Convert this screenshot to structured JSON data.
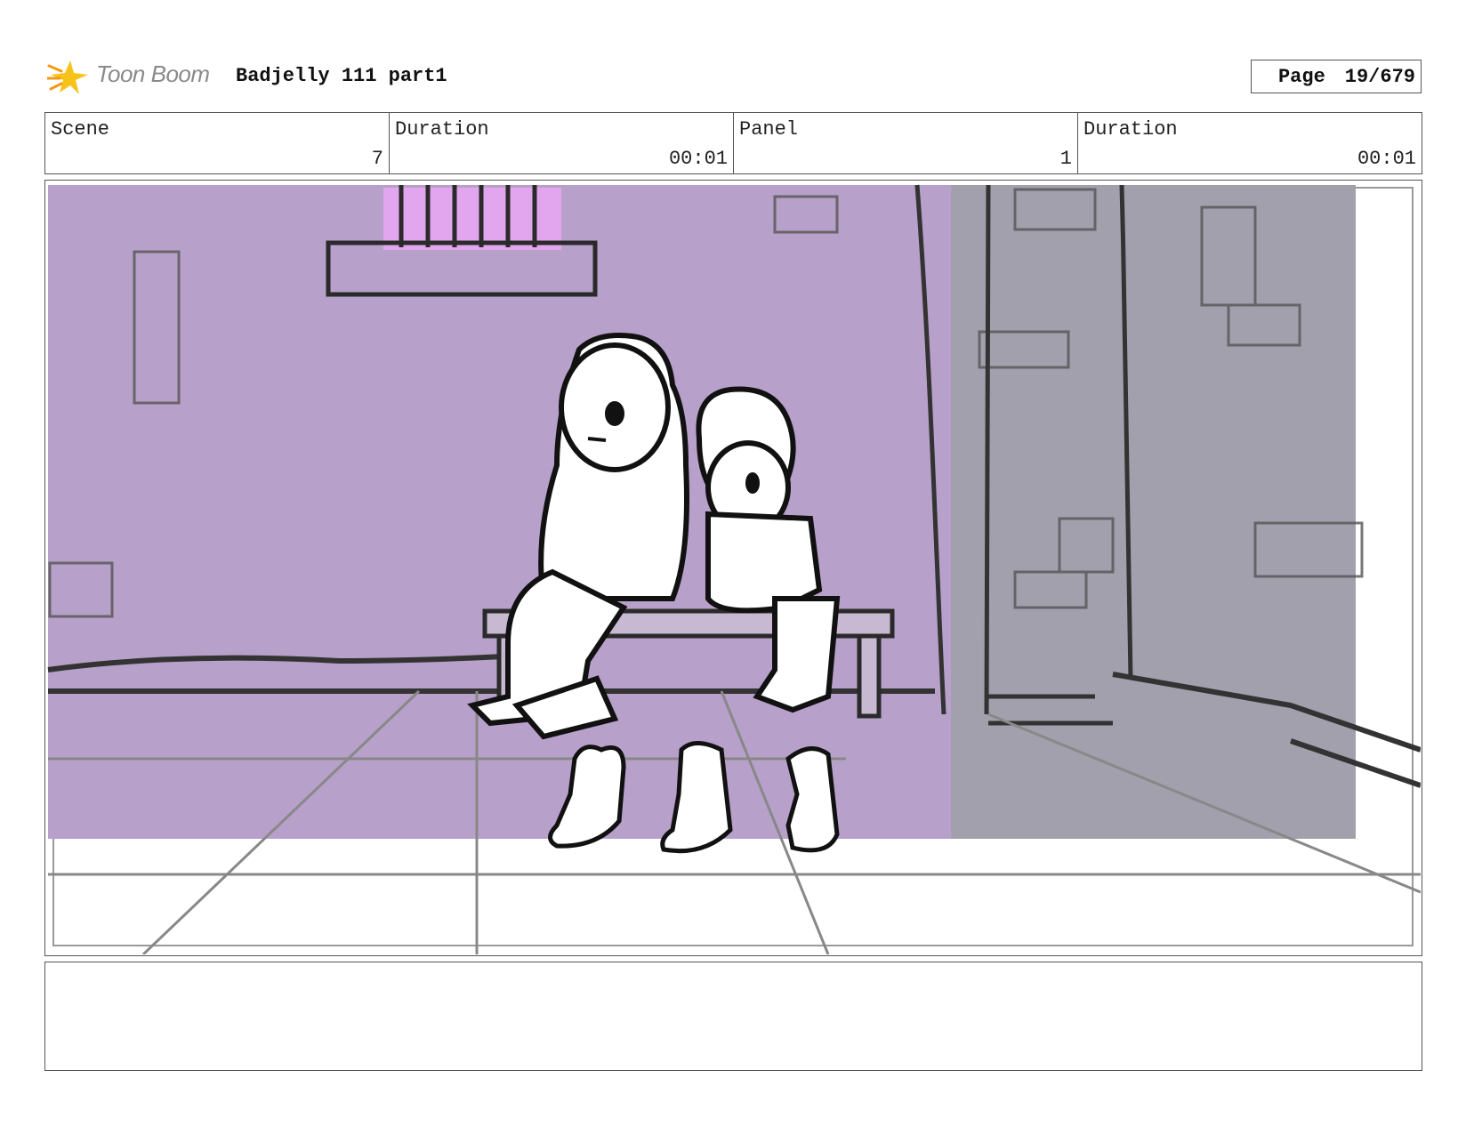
{
  "header": {
    "logo_text": "Toon Boom",
    "title": "Badjelly 111 part1",
    "page_label": "Page",
    "page_value": "19/679"
  },
  "info": {
    "scene_label": "Scene",
    "scene_value": "7",
    "scene_duration_label": "Duration",
    "scene_duration_value": "00:01",
    "panel_label": "Panel",
    "panel_value": "1",
    "panel_duration_label": "Duration",
    "panel_duration_value": "00:01"
  },
  "colors": {
    "wall_purple": "#b7a0c9",
    "pillar_gray": "#9fa0a8",
    "window_pink": "#e2a6ee",
    "ink": "#1a1a1a"
  },
  "icons": {
    "logo": "toon-boom-star-logo"
  },
  "panel": {
    "image_description": ""
  },
  "notes": {
    "text": ""
  }
}
